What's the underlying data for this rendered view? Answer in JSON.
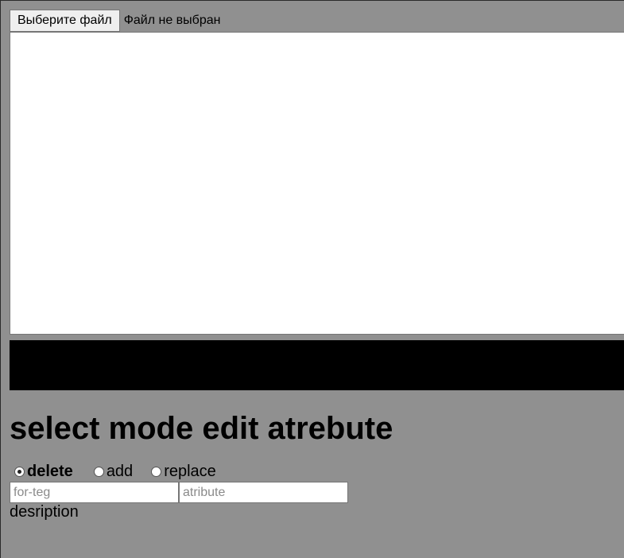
{
  "file_picker": {
    "button_label": "Выберите файл",
    "status": "Файл не выбран"
  },
  "editor": {
    "value": ""
  },
  "section": {
    "title": "select mode edit atrebute"
  },
  "modes": [
    {
      "label": "delete",
      "checked": true
    },
    {
      "label": "add",
      "checked": false
    },
    {
      "label": "replace",
      "checked": false
    }
  ],
  "inputs": {
    "tag_placeholder": "for-teg",
    "attribute_placeholder": "atribute"
  },
  "description": {
    "text": "desription"
  },
  "colors": {
    "background": "#909090",
    "output_bar": "#000000"
  }
}
